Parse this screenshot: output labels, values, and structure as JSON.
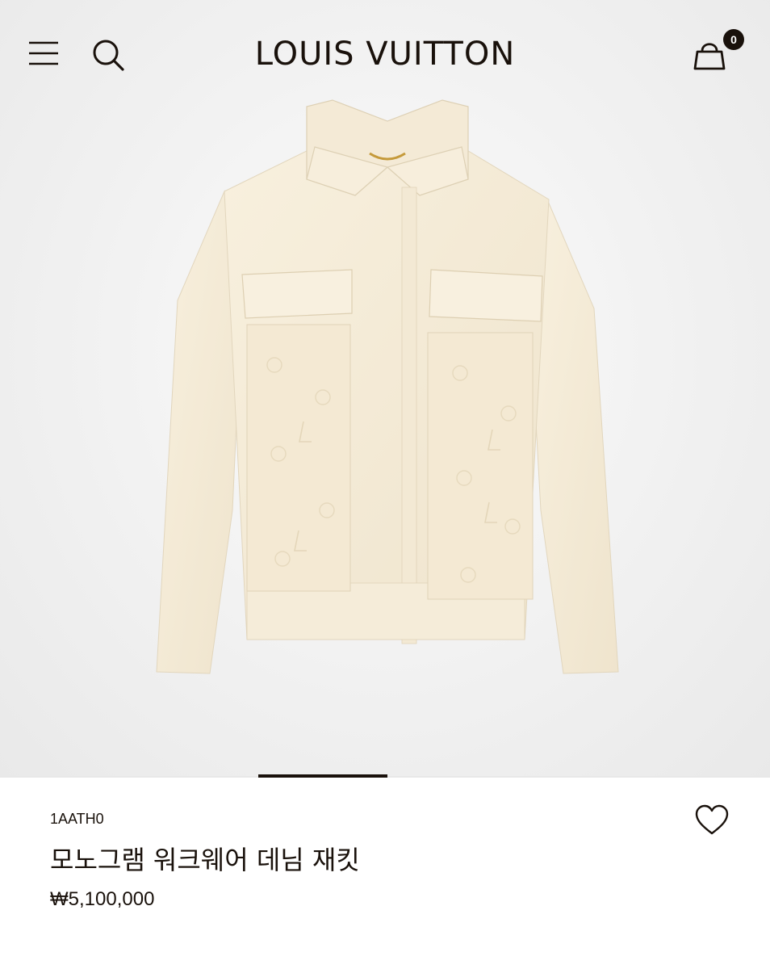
{
  "header": {
    "brand": "LOUIS VUITTON",
    "menu_icon": "hamburger-menu-icon",
    "search_icon": "search-icon",
    "bag_icon": "shopping-bag-icon",
    "bag_count": "0"
  },
  "product": {
    "sku": "1AATH0",
    "name": "모노그램 워크웨어 데님 재킷",
    "price": "₩5,100,000",
    "image_alt": "cream monogram workwear denim jacket",
    "wishlist_icon": "heart-icon"
  },
  "carousel": {
    "active_index": 1
  },
  "colors": {
    "text": "#19110b",
    "background": "#ffffff",
    "hero_background": "#f0f0f0",
    "jacket": "#f6eddb"
  }
}
